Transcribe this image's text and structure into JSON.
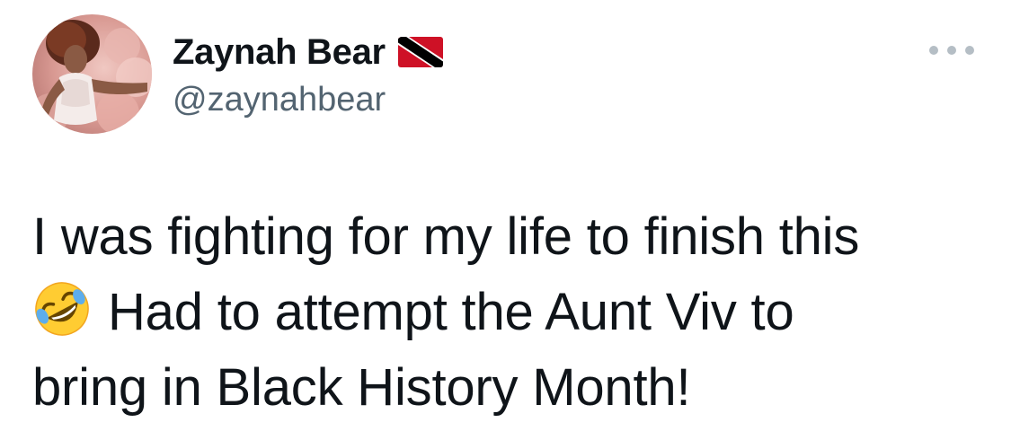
{
  "tweet": {
    "author": {
      "display_name": "Zaynah Bear",
      "handle": "@zaynahbear",
      "flag_icon": "trinidad-and-tobago-flag-icon"
    },
    "more_icon": "ellipsis-icon",
    "text": {
      "line1": "I was fighting for my life to finish this",
      "emoji_icon": "rolling-on-the-floor-laughing-emoji",
      "line2": "Had to attempt the Aunt Viv to",
      "line3": "bring in Black History Month!"
    }
  },
  "colors": {
    "text_primary": "#0f1419",
    "text_secondary": "#536471",
    "background": "#ffffff",
    "more_dots": "#b5bec5"
  }
}
